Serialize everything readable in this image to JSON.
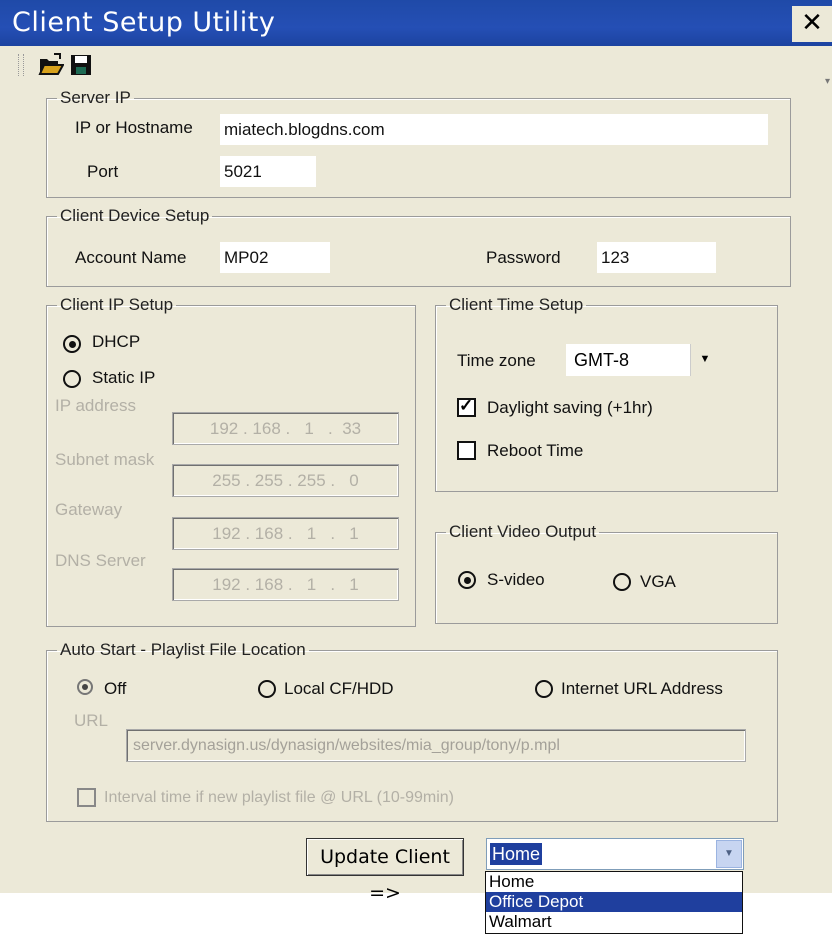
{
  "window": {
    "title": "Client Setup Utility",
    "close_label": "✕"
  },
  "toolbar": {
    "open_icon": "open-folder-icon",
    "save_icon": "save-disk-icon",
    "overflow": "▾"
  },
  "server_ip": {
    "legend": "Server IP",
    "host_label": "IP or Hostname",
    "host_value": "miatech.blogdns.com",
    "port_label": "Port",
    "port_value": "5021"
  },
  "device": {
    "legend": "Client Device Setup",
    "account_label": "Account Name",
    "account_value": "MP02",
    "password_label": "Password",
    "password_value": "123"
  },
  "ip_setup": {
    "legend": "Client IP Setup",
    "dhcp_label": "DHCP",
    "dhcp_selected": true,
    "static_label": "Static IP",
    "ip_label": "IP address",
    "ip_value": "192 . 168 .   1   .  33",
    "subnet_label": "Subnet mask",
    "subnet_value": "255 . 255 . 255 .   0",
    "gateway_label": "Gateway",
    "gateway_value": "192 . 168 .   1   .   1",
    "dns_label": "DNS Server",
    "dns_value": "192 . 168 .   1   .   1"
  },
  "time_setup": {
    "legend": "Client Time Setup",
    "tz_label": "Time zone",
    "tz_value": "GMT-8",
    "daylight_label": "Daylight saving (+1hr)",
    "daylight_checked": true,
    "reboot_label": "Reboot Time",
    "reboot_checked": false
  },
  "video": {
    "legend": "Client Video Output",
    "svideo_label": "S-video",
    "svideo_selected": true,
    "vga_label": "VGA"
  },
  "autostart": {
    "legend": "Auto Start - Playlist File Location",
    "off_label": "Off",
    "off_selected": true,
    "local_label": "Local CF/HDD",
    "url_option_label": "Internet URL Address",
    "url_label": "URL",
    "url_value": "server.dynasign.us/dynasign/websites/mia_group/tony/p.mpl",
    "interval_label": "Interval time if new playlist file @ URL (10-99min)"
  },
  "footer": {
    "update_button": "Update Client =>",
    "combo_value": "Home",
    "options": [
      "Home",
      "Office Depot",
      "Walmart"
    ],
    "highlighted_option": "Office Depot"
  }
}
